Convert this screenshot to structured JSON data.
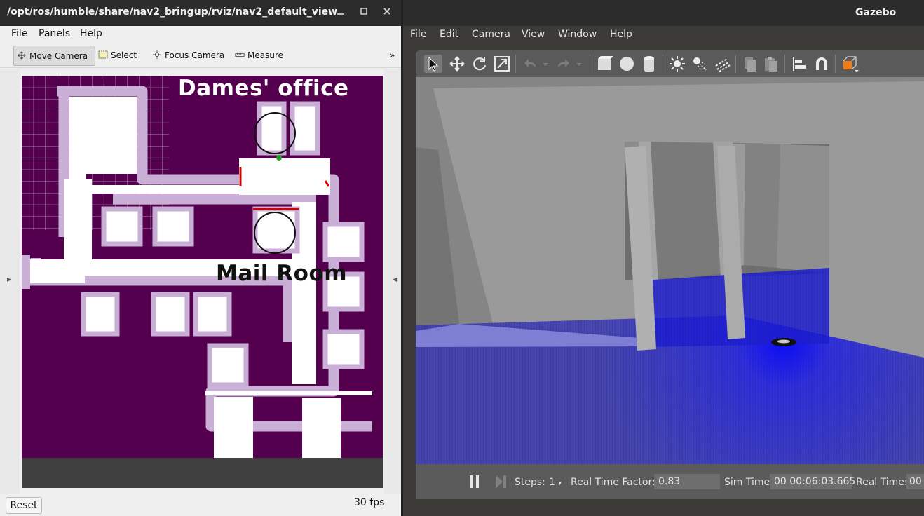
{
  "rviz": {
    "title": "/opt/ros/humble/share/nav2_bringup/rviz/nav2_default_view.r...",
    "menu": [
      "File",
      "Panels",
      "Help"
    ],
    "tools": [
      "Move Camera",
      "Select",
      "Focus Camera",
      "Measure"
    ],
    "overflow": "»",
    "labels": {
      "office": "Dames' office",
      "mail": "Mail Room"
    },
    "reset": "Reset",
    "fps": "30 fps"
  },
  "gazebo": {
    "title": "Gazebo",
    "menu": [
      "File",
      "Edit",
      "Camera",
      "View",
      "Window",
      "Help"
    ],
    "steps_label": "Steps:",
    "steps_value": "1",
    "rtf_label": "Real Time Factor:",
    "rtf_value": "0.83",
    "sim_label": "Sim Time:",
    "sim_value": "00 00:06:03.665",
    "real_label": "Real Time:",
    "real_value": "00"
  }
}
